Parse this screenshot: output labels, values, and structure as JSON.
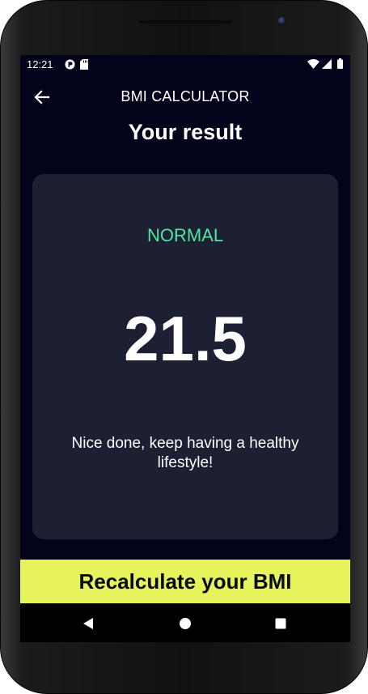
{
  "status_bar": {
    "time": "12:21",
    "icons": [
      "app-notification-icon",
      "sd-card-icon",
      "wifi-icon",
      "signal-icon",
      "battery-icon"
    ]
  },
  "app_bar": {
    "back_icon": "arrow-back-icon",
    "title": "BMI CALCULATOR"
  },
  "result": {
    "heading": "Your result",
    "status": "NORMAL",
    "status_color": "#4fe6a0",
    "bmi": "21.5",
    "message": "Nice done, keep having a healthy lifestyle!"
  },
  "action": {
    "label": "Recalculate your BMI",
    "color": "#e6f35d"
  },
  "colors": {
    "background": "#03031c",
    "card": "#1d1f33"
  },
  "nav_bar": {
    "icons": [
      "back-triangle-icon",
      "home-circle-icon",
      "recents-square-icon"
    ]
  }
}
